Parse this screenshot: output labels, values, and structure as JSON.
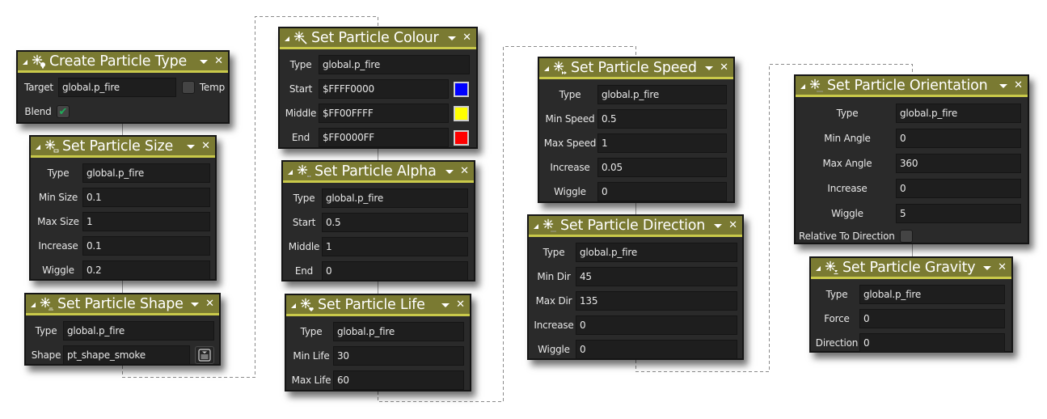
{
  "colors": {
    "header_bg": "#7a7a32",
    "header_accent": "#c9c94a",
    "node_bg": "#2a2a2a",
    "field_bg": "#1e1e1e",
    "check_green": "#1fae5a"
  },
  "nodes": {
    "create_particle_type": {
      "title": "Create Particle Type",
      "icon": "particle-bulb-icon",
      "target_label": "Target",
      "target_value": "global.p_fire",
      "temp_label": "Temp",
      "temp_checked": false,
      "blend_label": "Blend",
      "blend_checked": true
    },
    "set_particle_size": {
      "title": "Set Particle Size",
      "icon": "particle-size-icon",
      "rows": [
        {
          "label": "Type",
          "value": "global.p_fire"
        },
        {
          "label": "Min Size",
          "value": "0.1"
        },
        {
          "label": "Max Size",
          "value": "1"
        },
        {
          "label": "Increase",
          "value": "0.1"
        },
        {
          "label": "Wiggle",
          "value": "0.2"
        }
      ]
    },
    "set_particle_shape": {
      "title": "Set Particle Shape",
      "icon": "particle-shape-icon",
      "rows": [
        {
          "label": "Type",
          "value": "global.p_fire"
        },
        {
          "label": "Shape",
          "value": "pt_shape_smoke"
        }
      ]
    },
    "set_particle_colour": {
      "title": "Set Particle Colour",
      "icon": "particle-colour-icon",
      "rows": [
        {
          "label": "Type",
          "value": "global.p_fire"
        },
        {
          "label": "Start",
          "value": "$FFFF0000",
          "swatch": "#0000ff"
        },
        {
          "label": "Middle",
          "value": "$FF00FFFF",
          "swatch": "#ffff00"
        },
        {
          "label": "End",
          "value": "$FF0000FF",
          "swatch": "#ff0000"
        }
      ]
    },
    "set_particle_alpha": {
      "title": "Set Particle Alpha",
      "icon": "particle-alpha-icon",
      "rows": [
        {
          "label": "Type",
          "value": "global.p_fire"
        },
        {
          "label": "Start",
          "value": "0.5"
        },
        {
          "label": "Middle",
          "value": "1"
        },
        {
          "label": "End",
          "value": "0"
        }
      ]
    },
    "set_particle_life": {
      "title": "Set Particle Life",
      "icon": "particle-life-icon",
      "rows": [
        {
          "label": "Type",
          "value": "global.p_fire"
        },
        {
          "label": "Min Life",
          "value": "30"
        },
        {
          "label": "Max Life",
          "value": "60"
        }
      ]
    },
    "set_particle_speed": {
      "title": "Set Particle Speed",
      "icon": "particle-speed-icon",
      "rows": [
        {
          "label": "Type",
          "value": "global.p_fire"
        },
        {
          "label": "Min Speed",
          "value": "0.5"
        },
        {
          "label": "Max Speed",
          "value": "1"
        },
        {
          "label": "Increase",
          "value": "0.05"
        },
        {
          "label": "Wiggle",
          "value": "0"
        }
      ]
    },
    "set_particle_direction": {
      "title": "Set Particle Direction",
      "icon": "particle-direction-icon",
      "rows": [
        {
          "label": "Type",
          "value": "global.p_fire"
        },
        {
          "label": "Min Dir",
          "value": "45"
        },
        {
          "label": "Max Dir",
          "value": "135"
        },
        {
          "label": "Increase",
          "value": "0"
        },
        {
          "label": "Wiggle",
          "value": "0"
        }
      ]
    },
    "set_particle_orientation": {
      "title": "Set Particle Orientation",
      "icon": "particle-orientation-icon",
      "rows": [
        {
          "label": "Type",
          "value": "global.p_fire"
        },
        {
          "label": "Min Angle",
          "value": "0"
        },
        {
          "label": "Max Angle",
          "value": "360"
        },
        {
          "label": "Increase",
          "value": "0"
        },
        {
          "label": "Wiggle",
          "value": "5"
        }
      ],
      "relative_label": "Relative To Direction",
      "relative_checked": false
    },
    "set_particle_gravity": {
      "title": "Set Particle Gravity",
      "icon": "particle-gravity-icon",
      "rows": [
        {
          "label": "Type",
          "value": "global.p_fire"
        },
        {
          "label": "Force",
          "value": "0"
        },
        {
          "label": "Direction",
          "value": "0"
        }
      ]
    }
  }
}
